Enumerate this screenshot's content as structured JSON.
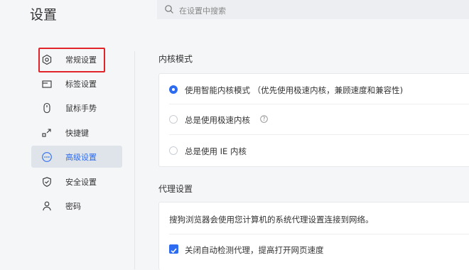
{
  "header": {
    "title": "设置",
    "search_placeholder": "在设置中搜索"
  },
  "sidebar": {
    "items": [
      {
        "label": "常规设置",
        "icon": "hexagon-settings-icon"
      },
      {
        "label": "标签设置",
        "icon": "tab-icon"
      },
      {
        "label": "鼠标手势",
        "icon": "mouse-icon"
      },
      {
        "label": "快捷键",
        "icon": "shortcut-icon"
      },
      {
        "label": "高级设置",
        "icon": "more-circle-icon"
      },
      {
        "label": "安全设置",
        "icon": "shield-icon"
      },
      {
        "label": "密码",
        "icon": "user-icon"
      }
    ],
    "active_index": 4,
    "highlighted_index": 0
  },
  "kernel": {
    "title": "内核模式",
    "options": [
      {
        "label": "使用智能内核模式 （优先使用极速内核，兼顾速度和兼容性)",
        "selected": true
      },
      {
        "label": "总是使用极速内核",
        "selected": false,
        "has_help": true
      },
      {
        "label": "总是使用 IE 内核",
        "selected": false
      }
    ]
  },
  "proxy": {
    "title": "代理设置",
    "description": "搜狗浏览器会使用您计算机的系统代理设置连接到网络。",
    "checkbox_label": "关闭自动检测代理，提高打开网页速度",
    "checked": true
  },
  "colors": {
    "accent": "#2d6cf0",
    "highlight_border": "#e0242a",
    "active_bg": "#dfe4ea"
  }
}
